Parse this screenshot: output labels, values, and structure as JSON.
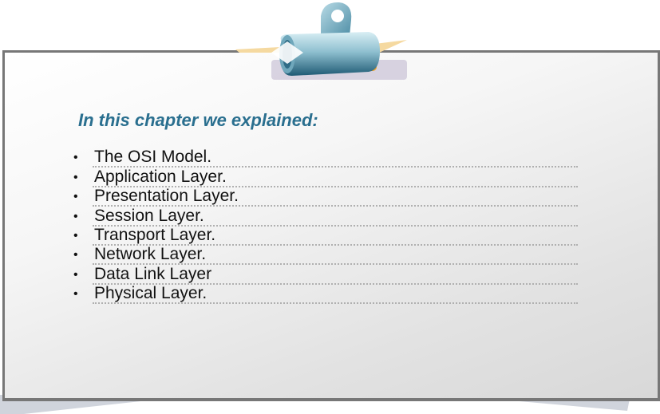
{
  "heading": "In this chapter we explained:",
  "bullet_glyph": "•",
  "items": [
    "The OSI Model.",
    "Application Layer.",
    "Presentation Layer.",
    "Session Layer.",
    "Transport Layer.",
    "Network Layer.",
    "Data Link Layer",
    "Physical Layer."
  ],
  "colors": {
    "heading": "#2a6f8f",
    "border": "#777777"
  },
  "icons": {
    "clip": "binder-clip-icon"
  }
}
